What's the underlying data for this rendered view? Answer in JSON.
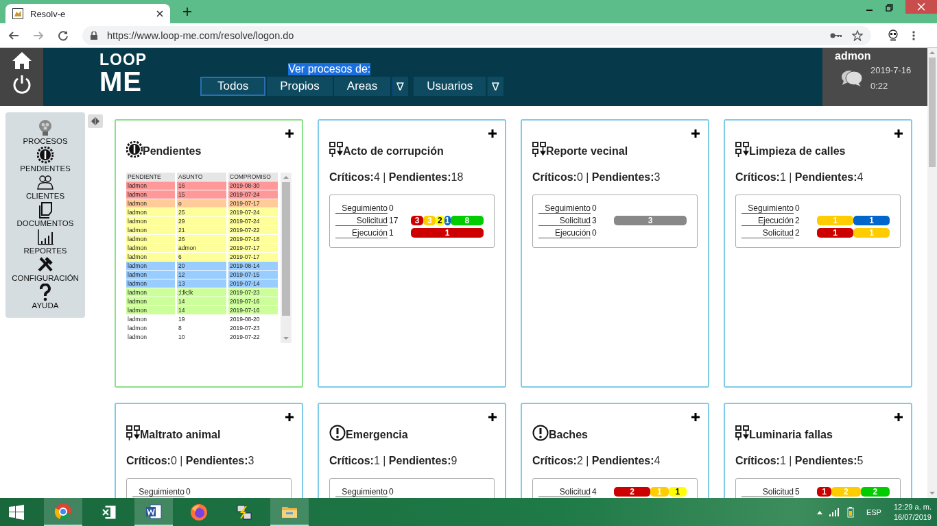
{
  "browser": {
    "tab_title": "Resolv-e",
    "url": "https://www.loop-me.com/resolve/logon.do"
  },
  "header": {
    "logo": {
      "top": "LOOP",
      "bottom": "ME"
    },
    "filter_label": "Ver procesos de:",
    "filters": [
      {
        "label": "Todos",
        "selected": true
      },
      {
        "label": "Propios",
        "selected": false
      },
      {
        "label": "Areas",
        "selected": false,
        "dropdown_glyph": "∇"
      },
      {
        "label": "Usuarios",
        "selected": false,
        "dropdown_glyph": "∇"
      }
    ],
    "user": {
      "name": "admon",
      "date": "2019-7-16",
      "time": "0:22"
    }
  },
  "sidebar": {
    "items": [
      {
        "label": "PROCESOS"
      },
      {
        "label": "PENDIENTES"
      },
      {
        "label": "CLIENTES"
      },
      {
        "label": "DOCUMENTOS"
      },
      {
        "label": "REPORTES"
      },
      {
        "label": "CONFIGURACIÓN"
      },
      {
        "label": "AYUDA"
      }
    ]
  },
  "cards": [
    {
      "kind": "table",
      "title": "Pendientes",
      "columns": [
        "PENDIENTE",
        "ASUNTO",
        "COMPROMISO"
      ],
      "rows": [
        {
          "cells": [
            "ladmon",
            "16",
            "2019-08-30"
          ],
          "color": "#ff9999"
        },
        {
          "cells": [
            "ladmon",
            "15",
            "2019-07-24"
          ],
          "color": "#ff9999"
        },
        {
          "cells": [
            "ladmon",
            "o",
            "2019-07-17"
          ],
          "color": "#ffcc99"
        },
        {
          "cells": [
            "ladmon",
            "25",
            "2019-07-24"
          ],
          "color": "#ffff99"
        },
        {
          "cells": [
            "ladmon",
            "29",
            "2019-07-24"
          ],
          "color": "#ffff99"
        },
        {
          "cells": [
            "ladmon",
            "21",
            "2019-07-22"
          ],
          "color": "#ffff99"
        },
        {
          "cells": [
            "ladmon",
            "26",
            "2019-07-18"
          ],
          "color": "#ffff99"
        },
        {
          "cells": [
            "ladmon",
            "admon",
            "2019-07-17"
          ],
          "color": "#ffff99"
        },
        {
          "cells": [
            "ladmon",
            "6",
            "2019-07-17"
          ],
          "color": "#ffff99"
        },
        {
          "cells": [
            "ladmon",
            "20",
            "2019-08-14"
          ],
          "color": "#99ccff"
        },
        {
          "cells": [
            "ladmon",
            "12",
            "2019-07-15"
          ],
          "color": "#99ccff"
        },
        {
          "cells": [
            "ladmon",
            "13",
            "2019-07-14"
          ],
          "color": "#99ccff"
        },
        {
          "cells": [
            "ladmon",
            ";l;lk;lk",
            "2019-07-23"
          ],
          "color": "#ccff99"
        },
        {
          "cells": [
            "ladmon",
            "14",
            "2019-07-16"
          ],
          "color": "#ccff99"
        },
        {
          "cells": [
            "ladmon",
            "14",
            "2019-07-16"
          ],
          "color": "#ccff99"
        },
        {
          "cells": [
            "ladmon",
            "19",
            "2019-08-20"
          ],
          "color": "#ffffff"
        },
        {
          "cells": [
            "ladmon",
            "8",
            "2019-07-23"
          ],
          "color": "#ffffff"
        },
        {
          "cells": [
            "ladmon",
            "10",
            "2019-07-22"
          ],
          "color": "#ffffff"
        }
      ]
    },
    {
      "kind": "workflow",
      "title": "Acto de corrupción",
      "stats": "**Críticos:**4 | **Pendientes:**18",
      "stages": [
        {
          "label": "Seguimiento",
          "count": "0"
        },
        {
          "label": "Solicitud",
          "count": "17",
          "segments": [
            {
              "value": "3",
              "color": "#cc0000"
            },
            {
              "value": "3",
              "color": "#ffcc00"
            },
            {
              "value": "2",
              "color": "#ffff00"
            },
            {
              "value": "1",
              "color": "#0066cc"
            },
            {
              "value": "8",
              "color": "#00cc00"
            }
          ]
        },
        {
          "label": "Ejecución",
          "count": "1",
          "segments": [
            {
              "value": "1",
              "color": "#cc0000"
            }
          ]
        }
      ]
    },
    {
      "kind": "workflow",
      "title": "Reporte vecinal",
      "stats": "**Críticos:**0 | **Pendientes:**3",
      "stages": [
        {
          "label": "Seguimiento",
          "count": "0"
        },
        {
          "label": "Solicitud",
          "count": "3",
          "segments": [
            {
              "value": "3",
              "color": "#888888"
            }
          ]
        },
        {
          "label": "Ejecución",
          "count": "0"
        }
      ]
    },
    {
      "kind": "workflow",
      "title": "Limpieza de calles",
      "stats": "**Críticos:**1 | **Pendientes:**4",
      "stages": [
        {
          "label": "Seguimiento",
          "count": "0"
        },
        {
          "label": "Ejecución",
          "count": "2",
          "segments": [
            {
              "value": "1",
              "color": "#ffcc00"
            },
            {
              "value": "1",
              "color": "#0066cc"
            }
          ]
        },
        {
          "label": "Solicitud",
          "count": "2",
          "segments": [
            {
              "value": "1",
              "color": "#cc0000"
            },
            {
              "value": "1",
              "color": "#ffcc00"
            }
          ]
        }
      ]
    },
    {
      "kind": "workflow",
      "title": "Maltrato animal",
      "stats": "**Críticos:**0 | **Pendientes:**3",
      "stages": [
        {
          "label": "Seguimiento",
          "count": "0"
        }
      ]
    },
    {
      "kind": "alert",
      "title": "Emergencia",
      "stats": "**Críticos:**1 | **Pendientes:**9",
      "stages": [
        {
          "label": "Seguimiento",
          "count": "0"
        }
      ]
    },
    {
      "kind": "alert",
      "title": "Baches",
      "stats": "**Críticos:**2 | **Pendientes:**4",
      "stages": [
        {
          "label": "Solicitud",
          "count": "4",
          "segments": [
            {
              "value": "2",
              "color": "#cc0000"
            },
            {
              "value": "1",
              "color": "#ffcc00"
            },
            {
              "value": "1",
              "color": "#ffff00"
            }
          ]
        }
      ]
    },
    {
      "kind": "workflow",
      "title": "Luminaria fallas",
      "stats": "**Críticos:**1 | **Pendientes:**5",
      "stages": [
        {
          "label": "Solicitud",
          "count": "5",
          "segments": [
            {
              "value": "1",
              "color": "#cc0000"
            },
            {
              "value": "2",
              "color": "#ffcc00"
            },
            {
              "value": "2",
              "color": "#00cc00"
            }
          ]
        }
      ]
    }
  ],
  "taskbar": {
    "language": "ESP",
    "time": "12:29 a. m.",
    "date": "16/07/2019"
  }
}
